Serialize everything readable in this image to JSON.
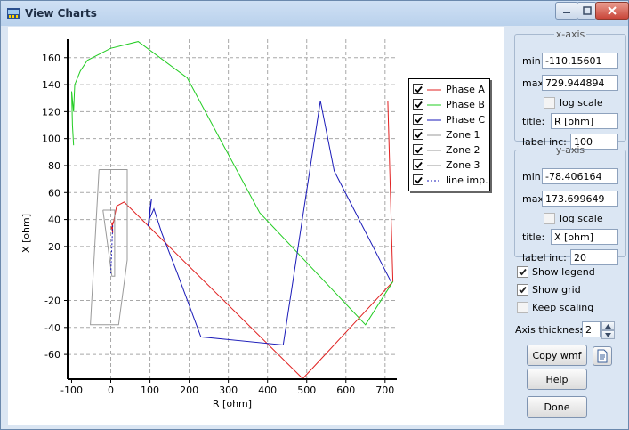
{
  "window": {
    "title": "View Charts",
    "controls": [
      "minimize",
      "maximize",
      "close"
    ]
  },
  "chart_data": {
    "type": "line",
    "xlabel": "R [ohm]",
    "ylabel": "X [ohm]",
    "xlim": [
      -110.15601,
      729.944894
    ],
    "ylim": [
      -78.406164,
      173.699649
    ],
    "x_ticks": [
      -100,
      0,
      100,
      200,
      300,
      400,
      500,
      600,
      700
    ],
    "y_ticks": [
      -60,
      -40,
      -20,
      20,
      40,
      60,
      80,
      100,
      120,
      140,
      160
    ],
    "grid": true,
    "legend_position": "top-right",
    "series": [
      {
        "name": "Phase A",
        "color": "#e02020",
        "points": [
          [
            707,
            128
          ],
          [
            720,
            -6
          ],
          [
            490,
            -78
          ],
          [
            34,
            53
          ],
          [
            15,
            50
          ],
          [
            7,
            38
          ],
          [
            2,
            34
          ],
          [
            5,
            30
          ],
          [
            4,
            38
          ],
          [
            2,
            36
          ]
        ]
      },
      {
        "name": "Phase B",
        "color": "#22cc22",
        "points": [
          [
            -95,
            95
          ],
          [
            -98,
            110
          ],
          [
            -100,
            135
          ],
          [
            -95,
            120
          ],
          [
            -92,
            140
          ],
          [
            -78,
            150
          ],
          [
            -60,
            158
          ],
          [
            0,
            167
          ],
          [
            70,
            172
          ],
          [
            195,
            145
          ],
          [
            380,
            45
          ],
          [
            650,
            -38
          ],
          [
            720,
            -6
          ]
        ]
      },
      {
        "name": "Phase C",
        "color": "#1a1ab8",
        "points": [
          [
            95,
            35
          ],
          [
            97,
            40
          ],
          [
            102,
            52
          ],
          [
            104,
            55
          ],
          [
            98,
            40
          ],
          [
            110,
            48
          ],
          [
            130,
            30
          ],
          [
            170,
            0
          ],
          [
            230,
            -47
          ],
          [
            440,
            -53
          ],
          [
            535,
            128
          ],
          [
            570,
            76
          ],
          [
            715,
            -6
          ]
        ]
      },
      {
        "name": "Zone 1",
        "color": "#999999",
        "points": [
          [
            -20,
            47
          ],
          [
            10,
            47
          ],
          [
            10,
            -2
          ],
          [
            3,
            -2
          ],
          [
            -20,
            47
          ]
        ]
      },
      {
        "name": "Zone 2",
        "color": "#999999",
        "points": [
          [
            -30,
            77
          ],
          [
            42,
            77
          ],
          [
            42,
            10
          ],
          [
            20,
            -38
          ],
          [
            -52,
            -38
          ],
          [
            -30,
            77
          ]
        ]
      },
      {
        "name": "Zone 3",
        "color": "#999999",
        "points": []
      },
      {
        "name": "line imp.",
        "color": "#1a1ab8",
        "style": "dashed",
        "points": [
          [
            0,
            0
          ],
          [
            5,
            36
          ]
        ]
      }
    ]
  },
  "legend_items": [
    {
      "label": "Phase A",
      "checked": true,
      "color": "#e02020",
      "dashed": false
    },
    {
      "label": "Phase B",
      "checked": true,
      "color": "#22cc22",
      "dashed": false
    },
    {
      "label": "Phase C",
      "checked": true,
      "color": "#1a1ab8",
      "dashed": false
    },
    {
      "label": "Zone 1",
      "checked": true,
      "color": "#999999",
      "dashed": false
    },
    {
      "label": "Zone 2",
      "checked": true,
      "color": "#999999",
      "dashed": false
    },
    {
      "label": "Zone 3",
      "checked": true,
      "color": "#999999",
      "dashed": false
    },
    {
      "label": "line imp.",
      "checked": true,
      "color": "#1a1ab8",
      "dashed": true
    }
  ],
  "x_axis": {
    "group_label": "x-axis",
    "min_label": "min:",
    "min_value": "-110.15601",
    "max_label": "max:",
    "max_value": "729.944894",
    "log_scale_label": "log scale",
    "log_scale": false,
    "title_label": "title:",
    "title_value": "R [ohm]",
    "label_inc_label": "label inc:",
    "label_inc_value": "100"
  },
  "y_axis": {
    "group_label": "y-axis",
    "min_label": "min:",
    "min_value": "-78.406164",
    "max_label": "max:",
    "max_value": "173.699649",
    "log_scale_label": "log scale",
    "log_scale": false,
    "title_label": "title:",
    "title_value": "X [ohm]",
    "label_inc_label": "label inc:",
    "label_inc_value": "20"
  },
  "options": {
    "show_legend_label": "Show legend",
    "show_legend": true,
    "show_grid_label": "Show grid",
    "show_grid": true,
    "keep_scaling_label": "Keep scaling",
    "keep_scaling": false,
    "axis_thickness_label": "Axis thickness:",
    "axis_thickness_value": "2"
  },
  "buttons": {
    "copy_wmf": "Copy wmf",
    "help": "Help",
    "done": "Done"
  },
  "icons": {
    "app": "chart-app-icon",
    "save": "save-document-icon"
  }
}
